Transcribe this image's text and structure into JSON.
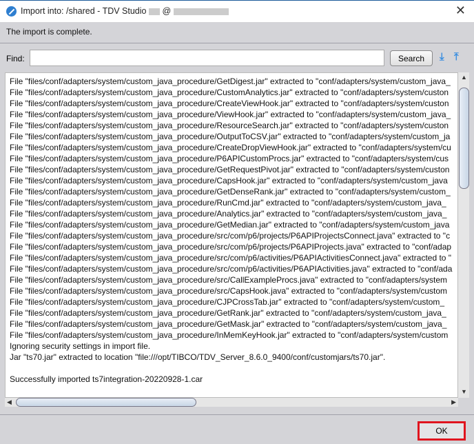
{
  "window": {
    "title": "Import into: /shared - TDV Studio",
    "title_at": "@",
    "close": "✕"
  },
  "status": "The import is complete.",
  "find": {
    "label": "Find:",
    "value": "",
    "search_label": "Search"
  },
  "log": [
    "File \"files/conf/adapters/system/custom_java_procedure/GetDigest.jar\" extracted to \"conf/adapters/system/custom_java_",
    "File \"files/conf/adapters/system/custom_java_procedure/CustomAnalytics.jar\" extracted to \"conf/adapters/system/custon",
    "File \"files/conf/adapters/system/custom_java_procedure/CreateViewHook.jar\" extracted to \"conf/adapters/system/custon",
    "File \"files/conf/adapters/system/custom_java_procedure/ViewHook.jar\" extracted to \"conf/adapters/system/custom_java_",
    "File \"files/conf/adapters/system/custom_java_procedure/ResourceSearch.jar\" extracted to \"conf/adapters/system/custon",
    "File \"files/conf/adapters/system/custom_java_procedure/OutputToCSV.jar\" extracted to \"conf/adapters/system/custom_ja",
    "File \"files/conf/adapters/system/custom_java_procedure/CreateDropViewHook.jar\" extracted to \"conf/adapters/system/cu",
    "File \"files/conf/adapters/system/custom_java_procedure/P6APICustomProcs.jar\" extracted to \"conf/adapters/system/cus",
    "File \"files/conf/adapters/system/custom_java_procedure/GetRequestPivot.jar\" extracted to \"conf/adapters/system/custon",
    "File \"files/conf/adapters/system/custom_java_procedure/CapsHook.jar\" extracted to \"conf/adapters/system/custom_java",
    "File \"files/conf/adapters/system/custom_java_procedure/GetDenseRank.jar\" extracted to \"conf/adapters/system/custom_",
    "File \"files/conf/adapters/system/custom_java_procedure/RunCmd.jar\" extracted to \"conf/adapters/system/custom_java_",
    "File \"files/conf/adapters/system/custom_java_procedure/Analytics.jar\" extracted to \"conf/adapters/system/custom_java_",
    "File \"files/conf/adapters/system/custom_java_procedure/GetMedian.jar\" extracted to \"conf/adapters/system/custom_java",
    "File \"files/conf/adapters/system/custom_java_procedure/src/com/p6/projects/P6APIProjectsConnect.java\" extracted to \"c",
    "File \"files/conf/adapters/system/custom_java_procedure/src/com/p6/projects/P6APIProjects.java\" extracted to \"conf/adap",
    "File \"files/conf/adapters/system/custom_java_procedure/src/com/p6/activities/P6APIActivitiesConnect.java\" extracted to \"",
    "File \"files/conf/adapters/system/custom_java_procedure/src/com/p6/activities/P6APIActivities.java\" extracted to \"conf/ada",
    "File \"files/conf/adapters/system/custom_java_procedure/src/CallExampleProcs.java\" extracted to \"conf/adapters/system",
    "File \"files/conf/adapters/system/custom_java_procedure/src/CapsHook.java\" extracted to \"conf/adapters/system/custom",
    "File \"files/conf/adapters/system/custom_java_procedure/CJPCrossTab.jar\" extracted to \"conf/adapters/system/custom_",
    "File \"files/conf/adapters/system/custom_java_procedure/GetRank.jar\" extracted to \"conf/adapters/system/custom_java_",
    "File \"files/conf/adapters/system/custom_java_procedure/GetMask.jar\" extracted to \"conf/adapters/system/custom_java_",
    "File \"files/conf/adapters/system/custom_java_procedure/InMemKeyHook.jar\" extracted to \"conf/adapters/system/custom",
    "Ignoring security settings in import file.",
    "Jar \"ts70.jar\" extracted to location \"file:///opt/TIBCO/TDV_Server_8.6.0_9400/conf/customjars/ts70.jar\".",
    "",
    "Successfully imported ts7integration-20220928-1.car"
  ],
  "footer": {
    "ok_label": "OK"
  }
}
